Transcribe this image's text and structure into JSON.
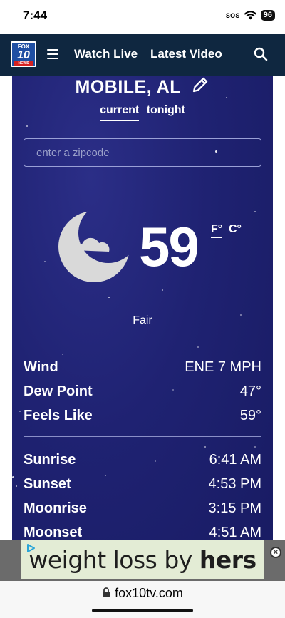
{
  "status_bar": {
    "time": "7:44",
    "carrier": "SOS",
    "battery": "96"
  },
  "nav": {
    "logo": {
      "top": "FOX",
      "number": "10",
      "bottom": "NEWS"
    },
    "links": [
      "Watch Live",
      "Latest Video"
    ]
  },
  "weather": {
    "city": "MOBILE, AL",
    "tabs": [
      {
        "label": "current",
        "active": true
      },
      {
        "label": "tonight",
        "active": false
      }
    ],
    "zip_placeholder": "enter a zipcode",
    "temperature": "59",
    "unit_f": "F°",
    "unit_c": "C°",
    "condition": "Fair",
    "condition_icon": "moon-cloud-icon",
    "details": [
      {
        "label": "Wind",
        "value": "ENE 7 MPH"
      },
      {
        "label": "Dew Point",
        "value": "47°"
      },
      {
        "label": "Feels Like",
        "value": "59°"
      }
    ],
    "astronomy": [
      {
        "label": "Sunrise",
        "value": "6:41 AM"
      },
      {
        "label": "Sunset",
        "value": "4:53 PM"
      },
      {
        "label": "Moonrise",
        "value": "3:15 PM"
      },
      {
        "label": "Moonset",
        "value": "4:51 AM"
      }
    ]
  },
  "ad": {
    "text_regular": "weight loss by ",
    "text_bold": "hers"
  },
  "browser": {
    "url": "fox10tv.com"
  },
  "colors": {
    "nav_bg": "#0f2740",
    "panel_bg": "#1f2272",
    "ad_bg": "#e3ecd5"
  }
}
